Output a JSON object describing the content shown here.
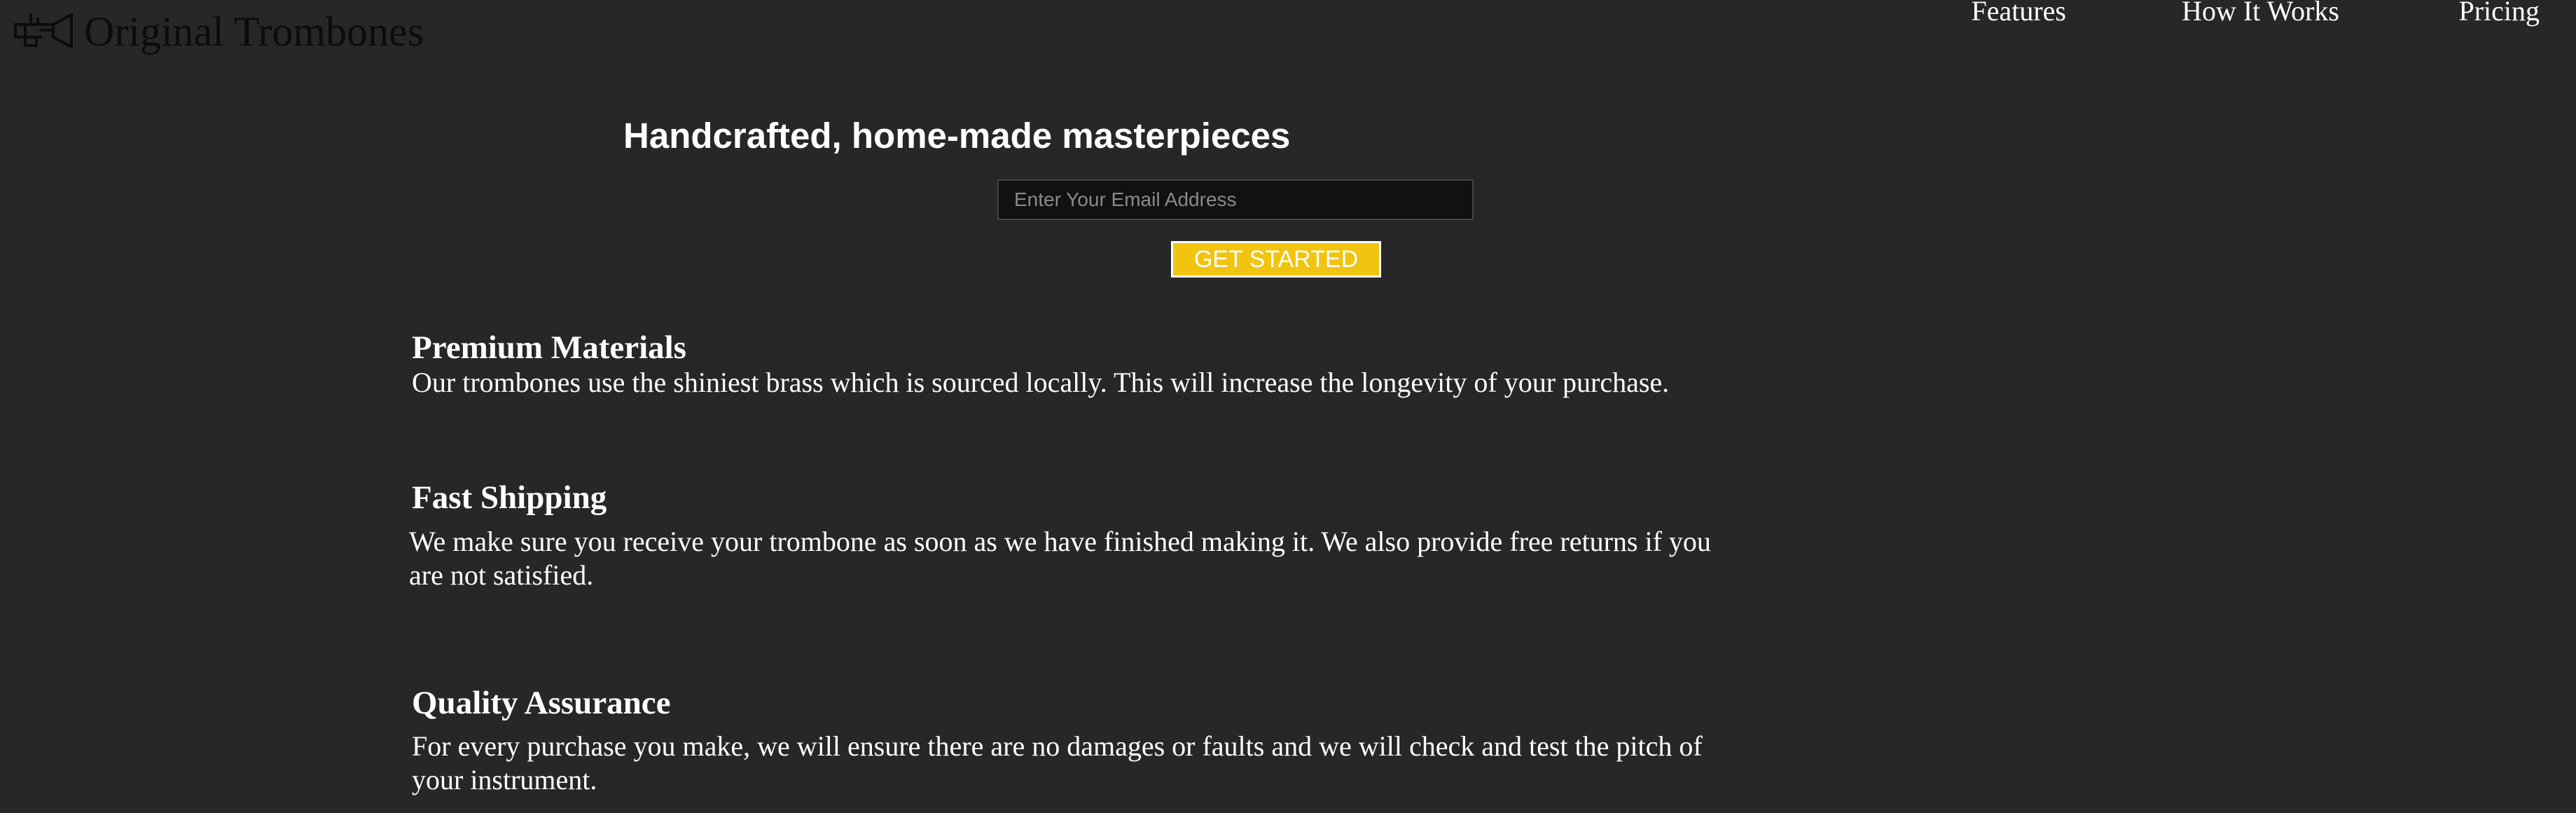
{
  "header": {
    "brand_name": "Original Trombones",
    "logo_icon": "trombone-icon",
    "nav": [
      {
        "label": "Features"
      },
      {
        "label": "How It Works"
      },
      {
        "label": "Pricing"
      }
    ]
  },
  "hero": {
    "title": "Handcrafted, home-made masterpieces",
    "email_placeholder": "Enter Your Email Address",
    "cta_label": "GET STARTED"
  },
  "features": [
    {
      "title": "Premium Materials",
      "text": "Our trombones use the shiniest brass which is sourced locally. This will increase the longevity of your purchase."
    },
    {
      "title": "Fast Shipping",
      "text": "We make sure you receive your trombone as soon as we have finished making it. We also provide free returns if you are not satisfied."
    },
    {
      "title": "Quality Assurance",
      "text": "For every purchase you make, we will ensure there are no damages or faults and we will check and test the pitch of your instrument."
    }
  ],
  "colors": {
    "background": "#272727",
    "accent": "#f1c40f",
    "text": "#ffffff"
  }
}
